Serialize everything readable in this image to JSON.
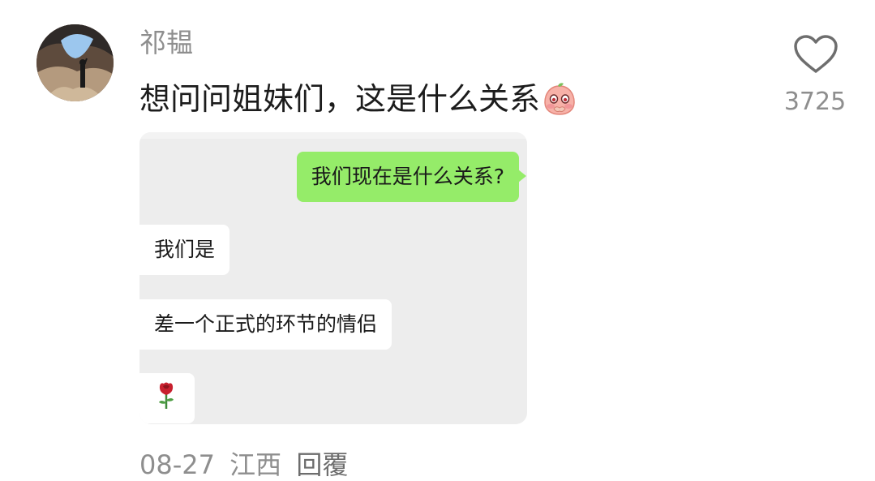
{
  "comment": {
    "username": "祁韫",
    "text": "想问问姐妹们，这是什么关系",
    "emoji": "blush-peach-emoji",
    "likes": "3725",
    "date": "08-27",
    "location": "江西",
    "reply_label": "回覆"
  },
  "attached_chat": {
    "messages": [
      {
        "side": "right",
        "text": "我们现在是什么关系?"
      },
      {
        "side": "left",
        "text": "我们是"
      },
      {
        "side": "left",
        "text": "差一个正式的环节的情侣"
      },
      {
        "side": "left",
        "emoji": "rose-icon"
      }
    ]
  },
  "colors": {
    "sent_bubble": "#95ec69",
    "received_bubble": "#ffffff",
    "chat_background": "#ededed",
    "meta_text": "#8e8e8e"
  }
}
